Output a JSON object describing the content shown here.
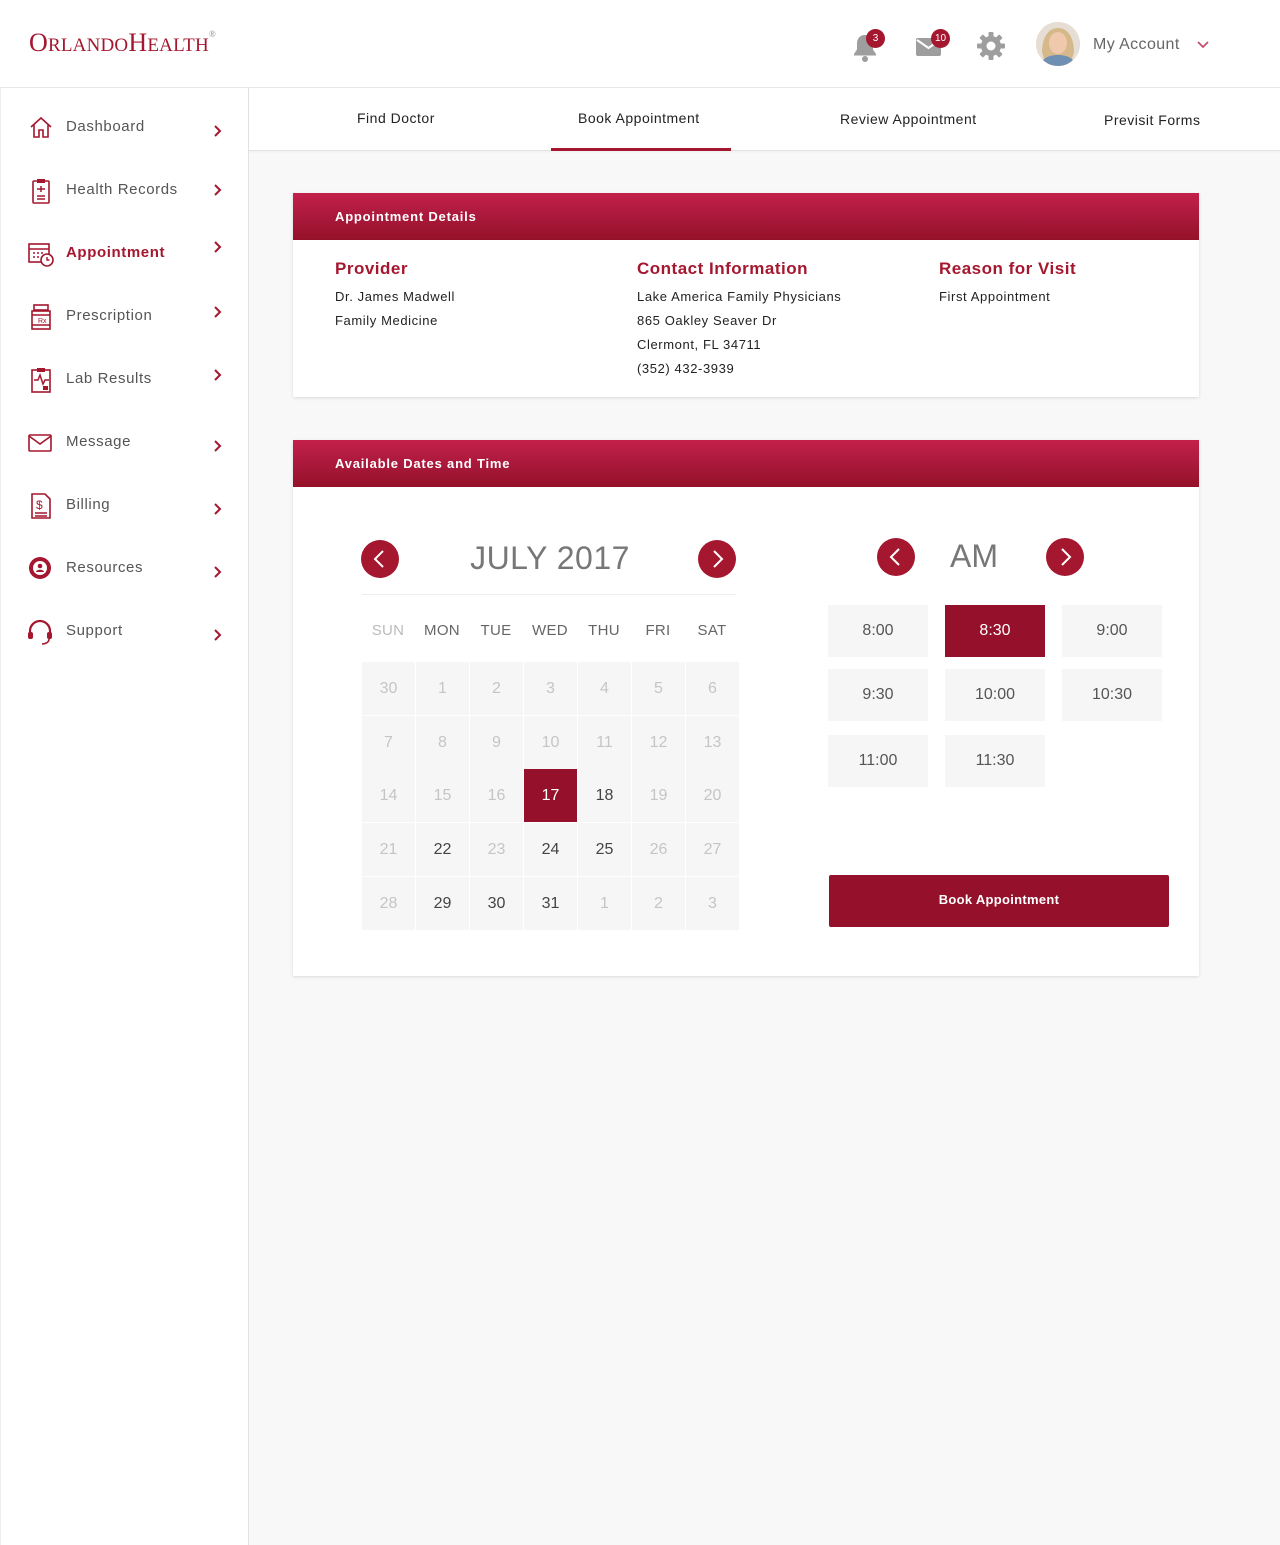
{
  "header": {
    "logo_big1": "O",
    "logo_small1": "RLANDO",
    "logo_big2": "H",
    "logo_small2": "EALTH",
    "logo_mark": "®",
    "notifications_count": "3",
    "messages_count": "10",
    "account_label": "My Account",
    "brand_color": "#a4172f"
  },
  "sidebar": {
    "items": [
      {
        "label": "Dashboard",
        "icon": "home-icon"
      },
      {
        "label": "Health Records",
        "icon": "clipboard-icon"
      },
      {
        "label": "Appointment",
        "icon": "calendar-clock-icon",
        "active": true
      },
      {
        "label": "Prescription",
        "icon": "pill-bottle-icon"
      },
      {
        "label": "Lab Results",
        "icon": "lab-chart-icon"
      },
      {
        "label": "Message",
        "icon": "envelope-icon"
      },
      {
        "label": "Billing",
        "icon": "bill-icon"
      },
      {
        "label": "Resources",
        "icon": "resources-icon"
      },
      {
        "label": "Support",
        "icon": "headset-icon"
      }
    ]
  },
  "tabs": [
    {
      "label": "Find Doctor"
    },
    {
      "label": "Book Appointment",
      "active": true
    },
    {
      "label": "Review Appointment"
    },
    {
      "label": "Previsit Forms"
    }
  ],
  "details": {
    "title": "Appointment Details",
    "provider": {
      "heading": "Provider",
      "lines": [
        "Dr. James Madwell",
        "Family Medicine"
      ]
    },
    "contact": {
      "heading": "Contact Information",
      "lines": [
        "Lake America Family Physicians",
        "865 Oakley Seaver Dr",
        "Clermont, FL 34711",
        "(352) 432-3939"
      ]
    },
    "reason": {
      "heading": "Reason for Visit",
      "lines": [
        "First Appointment"
      ]
    }
  },
  "availability": {
    "title": "Available Dates and Time",
    "month_label": "JULY 2017",
    "weekdays": [
      "SUN",
      "MON",
      "TUE",
      "WED",
      "THU",
      "FRI",
      "SAT"
    ],
    "weeks": [
      [
        "30",
        "1",
        "2",
        "3",
        "4",
        "5",
        "6"
      ],
      [
        "7",
        "8",
        "9",
        "10",
        "11",
        "12",
        "13"
      ],
      [
        "14",
        "15",
        "16",
        "17",
        "18",
        "19",
        "20"
      ],
      [
        "21",
        "22",
        "23",
        "24",
        "25",
        "26",
        "27"
      ],
      [
        "28",
        "29",
        "30",
        "31",
        "1",
        "2",
        "3"
      ]
    ],
    "available_dates": [
      "17",
      "18",
      "22",
      "24",
      "25",
      "29",
      "30",
      "31"
    ],
    "selected_date": "17",
    "period_label": "AM",
    "time_slots": [
      "8:00",
      "8:30",
      "9:00",
      "9:30",
      "10:00",
      "10:30",
      "11:00",
      "11:30"
    ],
    "selected_time": "8:30",
    "book_button": "Book Appointment"
  }
}
